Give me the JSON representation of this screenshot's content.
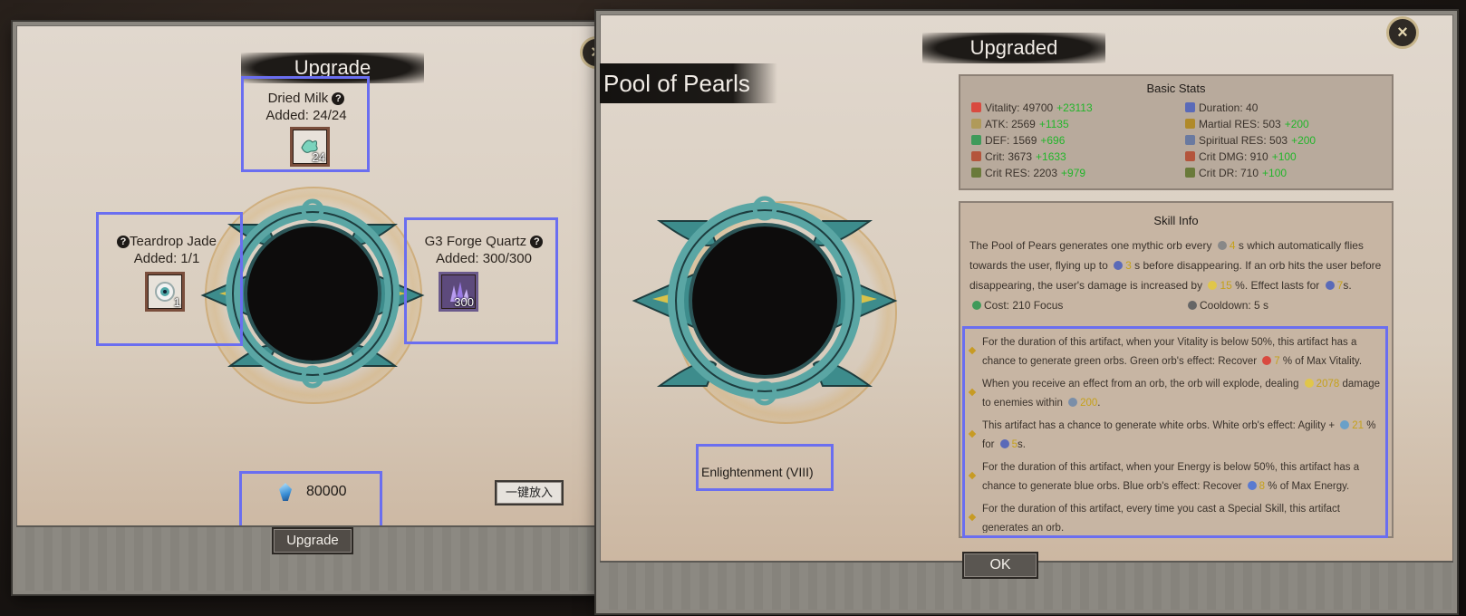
{
  "upgrade_panel": {
    "title": "Upgrade",
    "close_label": "×",
    "materials": [
      {
        "name": "Dried Milk",
        "added": "Added: 24/24",
        "count": "24"
      },
      {
        "name": "Teardrop Jade",
        "added": "Added: 1/1",
        "count": "1"
      },
      {
        "name": "G3 Forge Quartz",
        "added": "Added: 300/300",
        "count": "300"
      }
    ],
    "currency_value": "80000",
    "quick_add_label": "一键放入",
    "upgrade_button_label": "Upgrade"
  },
  "upgraded_panel": {
    "title": "Upgraded",
    "close_label": "×",
    "artifact_name": "Pool of Pearls",
    "tier": "Enlightenment (VIII)",
    "basic_stats": {
      "title": "Basic Stats",
      "left": [
        {
          "label": "Vitality: 49700",
          "bonus": "+23113",
          "color": "#d94a3f"
        },
        {
          "label": "ATK: 2569",
          "bonus": "+1135",
          "color": "#b09a5a"
        },
        {
          "label": "DEF: 1569",
          "bonus": "+696",
          "color": "#3f9a5a"
        },
        {
          "label": "Crit: 3673",
          "bonus": "+1633",
          "color": "#b4553c"
        },
        {
          "label": "Crit RES: 2203",
          "bonus": "+979",
          "color": "#6a7a3a"
        }
      ],
      "right": [
        {
          "label": "Duration: 40",
          "bonus": "",
          "color": "#5a6ab8"
        },
        {
          "label": "Martial RES: 503",
          "bonus": "+200",
          "color": "#b08a2a"
        },
        {
          "label": "Spiritual RES: 503",
          "bonus": "+200",
          "color": "#6a7aa0"
        },
        {
          "label": "Crit DMG: 910",
          "bonus": "+100",
          "color": "#b4553c"
        },
        {
          "label": "Crit DR: 710",
          "bonus": "+100",
          "color": "#6a7a3a"
        }
      ]
    },
    "skill_info": {
      "title": "Skill Info",
      "desc": {
        "p1": "The Pool of Pears generates one mythic orb every",
        "v1": "4",
        "p2": "s which automatically flies towards the user, flying up to",
        "v2": "3",
        "p3": "s before disappearing. If an orb hits the user before disappearing, the user's damage is increased by",
        "v3": "15",
        "p4": "%. Effect lasts for",
        "v4": "7",
        "p5": "s."
      },
      "cost": "Cost: 210 Focus",
      "cooldown": "Cooldown: 5 s",
      "effects": {
        "e1a": "For the duration of this artifact, when your Vitality is below 50%, this artifact has a chance to generate green orbs. Green orb's effect: Recover",
        "e1v": "7",
        "e1b": "% of Max Vitality.",
        "e2a": "When you receive an effect from an orb, the orb will explode, dealing",
        "e2v": "2078",
        "e2b": "damage to enemies within",
        "e2w": "200",
        "e2c": ".",
        "e3a": "This artifact has a chance to generate white orbs. White orb's effect: Agility +",
        "e3v": "21",
        "e3b": "% for",
        "e3w": "5",
        "e3c": "s.",
        "e4a": "For the duration of this artifact, when your Energy is below 50%, this artifact has a chance to generate blue orbs. Blue orb's effect: Recover",
        "e4v": "8",
        "e4b": "% of Max Energy.",
        "e5": "For the duration of this artifact, every time you cast a Special Skill, this artifact generates an orb."
      }
    },
    "ok_label": "OK"
  },
  "colors": {
    "highlight_box": "#6a6ef0",
    "bonus_green": "#22b52a",
    "value_gold": "#c6a11a",
    "frame_teal": "#5aa6a4"
  }
}
